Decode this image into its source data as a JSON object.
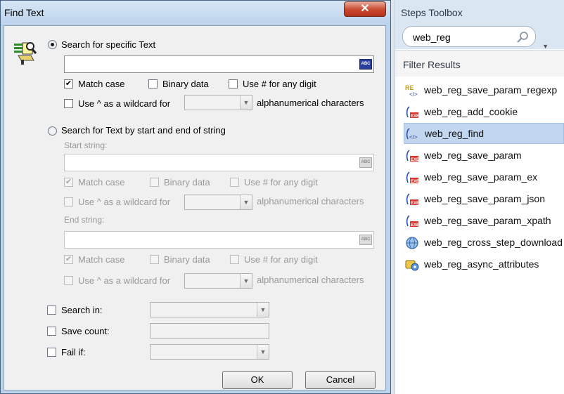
{
  "dialog": {
    "title": "Find Text",
    "close_glyph": "✕",
    "specific": {
      "label": "Search for specific Text",
      "selected": true,
      "text_value": "",
      "match_case": {
        "label": "Match case",
        "checked": true
      },
      "binary": {
        "label": "Binary data",
        "checked": false
      },
      "digit": {
        "label": "Use # for any digit",
        "checked": false
      },
      "wildcard": {
        "label": "Use ^ as a wildcard for",
        "checked": false
      },
      "alphanum": "alphanumerical characters",
      "wildcard_value": ""
    },
    "startend": {
      "label": "Search for Text by start and end of string",
      "selected": false,
      "start_label": "Start string:",
      "end_label": "End string:",
      "start_value": "",
      "end_value": "",
      "match_case": "Match case",
      "binary": "Binary data",
      "digit": "Use # for any digit",
      "wildcard": "Use ^ as a wildcard for",
      "alphanum": "alphanumerical characters"
    },
    "search_in": {
      "label": "Search in:",
      "value": ""
    },
    "save_count": {
      "label": "Save count:",
      "value": ""
    },
    "fail_if": {
      "label": "Fail if:",
      "value": ""
    },
    "ok_label": "OK",
    "cancel_label": "Cancel"
  },
  "toolbox": {
    "title": "Steps Toolbox",
    "search_value": "web_reg",
    "filter_label": "Filter Results",
    "items": [
      {
        "label": "web_reg_save_param_regexp",
        "icon": "regexp-step-icon",
        "selected": false
      },
      {
        "label": "web_reg_add_cookie",
        "icon": "exe-step-icon",
        "selected": false
      },
      {
        "label": "web_reg_find",
        "icon": "find-step-icon",
        "selected": true
      },
      {
        "label": "web_reg_save_param",
        "icon": "exe-step-icon",
        "selected": false
      },
      {
        "label": "web_reg_save_param_ex",
        "icon": "exe-step-icon",
        "selected": false
      },
      {
        "label": "web_reg_save_param_json",
        "icon": "exe-step-icon",
        "selected": false
      },
      {
        "label": "web_reg_save_param_xpath",
        "icon": "exe-step-icon",
        "selected": false
      },
      {
        "label": "web_reg_cross_step_download",
        "icon": "globe-step-icon",
        "selected": false
      },
      {
        "label": "web_reg_async_attributes",
        "icon": "async-step-icon",
        "selected": false
      }
    ]
  },
  "colors": {
    "titlebar": "#bcd3ec",
    "close_button": "#c8482e",
    "selection": "#c3d6ef",
    "toolbox_header": "#dbe6f3"
  }
}
